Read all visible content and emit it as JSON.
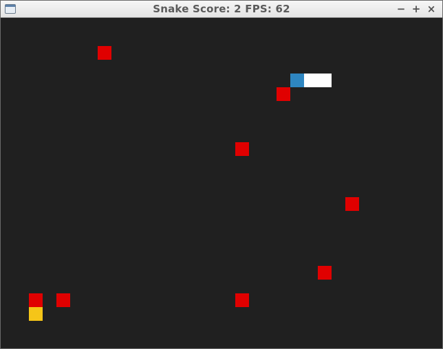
{
  "window": {
    "title": "Snake Score: 2 FPS: 62",
    "minimize_glyph": "−",
    "maximize_glyph": "+",
    "close_glyph": "×"
  },
  "game": {
    "score": 2,
    "fps": 62,
    "grid": {
      "cols": 32,
      "rows": 24
    },
    "colors": {
      "background": "#202020",
      "snake_head": "#2e86c1",
      "snake_body": "#ffffff",
      "obstacle": "#e00000",
      "food": "#f5c518"
    },
    "snake": {
      "head": [
        21,
        4
      ],
      "body": [
        [
          22,
          4
        ],
        [
          23,
          4
        ]
      ]
    },
    "obstacles": [
      [
        7,
        2
      ],
      [
        20,
        5
      ],
      [
        17,
        9
      ],
      [
        25,
        13
      ],
      [
        23,
        18
      ],
      [
        2,
        20
      ],
      [
        4,
        20
      ],
      [
        17,
        20
      ]
    ],
    "food": [
      2,
      21
    ]
  }
}
